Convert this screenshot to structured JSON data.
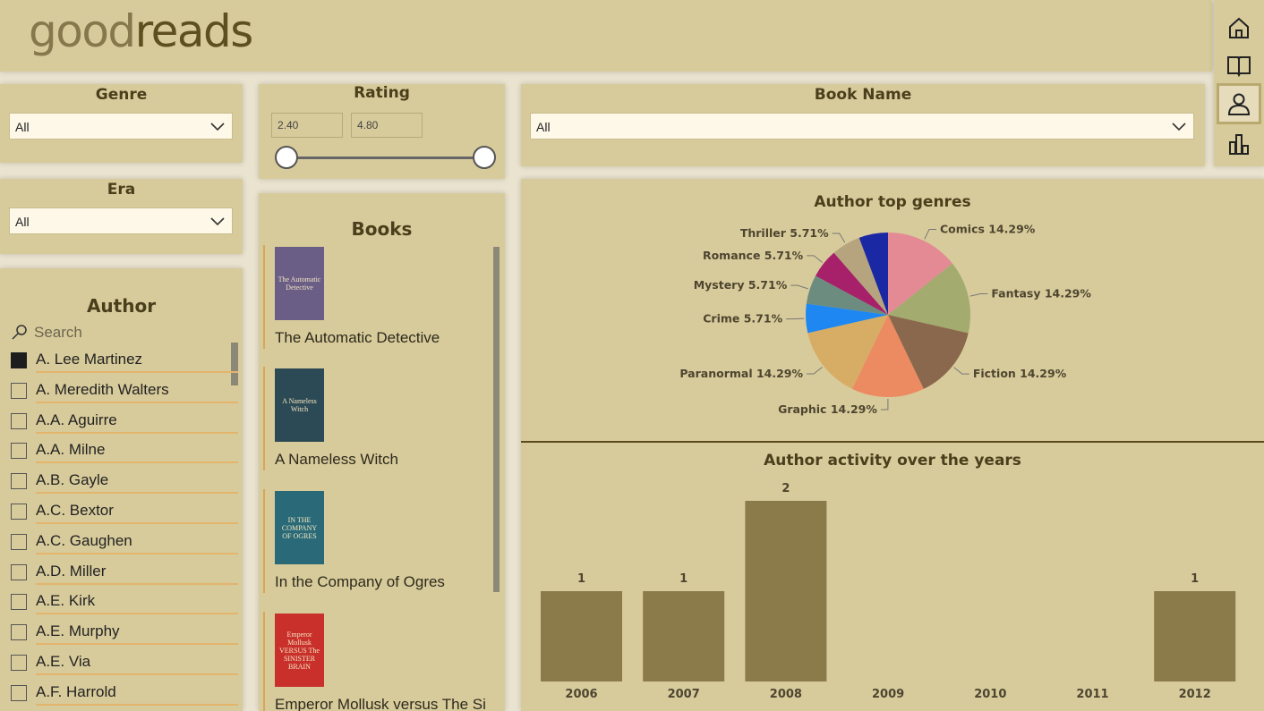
{
  "header": {
    "logo_light": "good",
    "logo_bold": "reads"
  },
  "nav": {
    "items": [
      {
        "icon": "home-icon"
      },
      {
        "icon": "book-icon"
      },
      {
        "icon": "person-icon",
        "active": true
      },
      {
        "icon": "bar-chart-icon"
      }
    ]
  },
  "filters": {
    "genre": {
      "label": "Genre",
      "value": "All"
    },
    "era": {
      "label": "Era",
      "value": "All"
    },
    "rating": {
      "label": "Rating",
      "min": "2.40",
      "max": "4.80",
      "range_min": 0.0,
      "range_max": 1.0
    },
    "book_name": {
      "label": "Book Name",
      "value": "All"
    }
  },
  "author": {
    "label": "Author",
    "search_placeholder": "Search",
    "items": [
      {
        "name": "A. Lee Martinez",
        "checked": true
      },
      {
        "name": "A. Meredith Walters",
        "checked": false
      },
      {
        "name": "A.A. Aguirre",
        "checked": false
      },
      {
        "name": "A.A. Milne",
        "checked": false
      },
      {
        "name": "A.B. Gayle",
        "checked": false
      },
      {
        "name": "A.C. Bextor",
        "checked": false
      },
      {
        "name": "A.C. Gaughen",
        "checked": false
      },
      {
        "name": "A.D. Miller",
        "checked": false
      },
      {
        "name": "A.E. Kirk",
        "checked": false
      },
      {
        "name": "A.E. Murphy",
        "checked": false
      },
      {
        "name": "A.E. Via",
        "checked": false
      },
      {
        "name": "A.F. Harrold",
        "checked": false
      }
    ]
  },
  "books": {
    "label": "Books",
    "items": [
      {
        "title": "The Automatic Detective",
        "cover_text": "The Automatic Detective",
        "cover_color": "#6a5d86"
      },
      {
        "title": "A Nameless Witch",
        "cover_text": "A Nameless Witch",
        "cover_color": "#2c4a55"
      },
      {
        "title": "In the Company of Ogres",
        "cover_text": "IN THE COMPANY OF OGRES",
        "cover_color": "#2a6a78"
      },
      {
        "title": "Emperor Mollusk versus The Si",
        "cover_text": "Emperor Mollusk VERSUS The SINISTER BRAIN",
        "cover_color": "#c9302c"
      }
    ]
  },
  "chart_data": [
    {
      "type": "pie",
      "title": "Author top genres",
      "slices": [
        {
          "label": "Comics 14.29%",
          "value": 14.29,
          "color": "#e48a94"
        },
        {
          "label": "Fantasy 14.29%",
          "value": 14.29,
          "color": "#a3ab6e"
        },
        {
          "label": "Fiction 14.29%",
          "value": 14.29,
          "color": "#8a684d"
        },
        {
          "label": "Graphic 14.29%",
          "value": 14.29,
          "color": "#ec8a62"
        },
        {
          "label": "Paranormal 14.29%",
          "value": 14.29,
          "color": "#d7ad66"
        },
        {
          "label": "Crime 5.71%",
          "value": 5.71,
          "color": "#1e87f2"
        },
        {
          "label": "Mystery 5.71%",
          "value": 5.71,
          "color": "#6b8c7f"
        },
        {
          "label": "Romance 5.71%",
          "value": 5.71,
          "color": "#a6206a"
        },
        {
          "label": "Thriller 5.71%",
          "value": 5.71,
          "color": "#b6a47e"
        },
        {
          "label": "",
          "value": 5.71,
          "color": "#1a28a3"
        }
      ]
    },
    {
      "type": "bar",
      "title": "Author activity over the years",
      "categories": [
        "2006",
        "2007",
        "2008",
        "2009",
        "2010",
        "2011",
        "2012"
      ],
      "values": [
        1,
        1,
        2,
        null,
        null,
        null,
        1
      ],
      "ylim": [
        0,
        2
      ],
      "bar_color": "#8b7b4b",
      "data_labels": true
    }
  ]
}
